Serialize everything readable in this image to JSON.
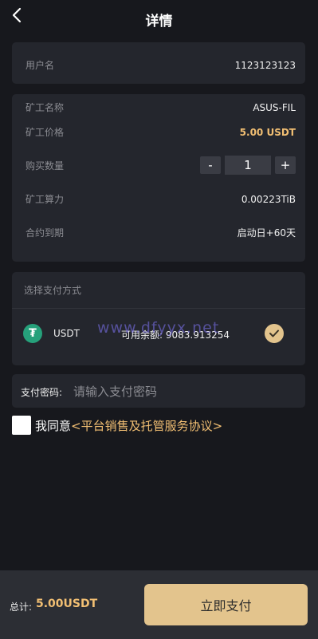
{
  "header": {
    "title": "详情"
  },
  "user": {
    "label": "用户名",
    "value": "1123123123"
  },
  "miner": {
    "name_label": "矿工名称",
    "name_value": "ASUS-FIL",
    "price_label": "矿工价格",
    "price_value": "5.00 USDT",
    "qty_label": "购买数量",
    "qty_minus": "-",
    "qty_value": "1",
    "qty_plus": "+",
    "power_label": "矿工算力",
    "power_value": "0.00223TiB",
    "expiry_label": "合约到期",
    "expiry_value": "启动日+60天"
  },
  "payment": {
    "title": "选择支付方式",
    "coin_icon": "₮",
    "coin": "USDT",
    "balance_label": "可用余额:",
    "balance_value": "9083.913254"
  },
  "watermark": "www.dfyyx.net",
  "password": {
    "label": "支付密码:",
    "placeholder": "请输入支付密码"
  },
  "agreement": {
    "text": "我同意",
    "link": "<平台销售及托管服务协议>"
  },
  "footer": {
    "total_label": "总计:",
    "total_value": "5.00USDT",
    "pay_button": "立即支付"
  },
  "colors": {
    "accent": "#f2bf73",
    "button": "#e3c48d",
    "background": "#17181d",
    "card": "#24262d",
    "tether": "#26a17b"
  },
  "icons": {
    "back": "chevron-left-icon",
    "selected": "checkmark-icon",
    "coin": "tether-icon"
  }
}
